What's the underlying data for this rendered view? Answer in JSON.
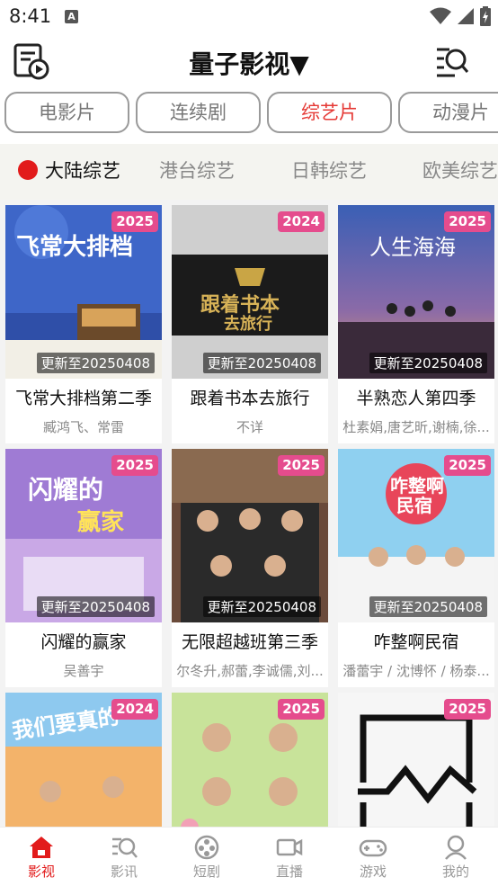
{
  "status": {
    "time": "8:41",
    "notif_letter": "A"
  },
  "header": {
    "title": "量子影视▼",
    "left_icon": "playlist-video-icon",
    "right_icon": "search-list-icon"
  },
  "categories": [
    {
      "label": "电影片",
      "active": false
    },
    {
      "label": "连续剧",
      "active": false
    },
    {
      "label": "综艺片",
      "active": true
    },
    {
      "label": "动漫片",
      "active": false
    }
  ],
  "subtabs": [
    {
      "label": "大陆综艺",
      "active": true
    },
    {
      "label": "港台综艺",
      "active": false
    },
    {
      "label": "日韩综艺",
      "active": false
    },
    {
      "label": "欧美综艺",
      "active": false
    }
  ],
  "cards": [
    {
      "title": "飞常大排档第二季",
      "cast": "臧鸿飞、常雷",
      "year": "2025",
      "update": "更新至20250408"
    },
    {
      "title": "跟着书本去旅行",
      "cast": "不详",
      "year": "2024",
      "update": "更新至20250408"
    },
    {
      "title": "半熟恋人第四季",
      "cast": "杜素娟,唐艺昕,谢楠,徐...",
      "year": "2025",
      "update": "更新至20250408"
    },
    {
      "title": "闪耀的赢家",
      "cast": "吴善宇",
      "year": "2025",
      "update": "更新至20250408"
    },
    {
      "title": "无限超越班第三季",
      "cast": "尔冬升,郝蕾,李诚儒,刘...",
      "year": "2025",
      "update": "更新至20250408"
    },
    {
      "title": "咋整啊民宿",
      "cast": "潘蕾宇 / 沈博怀 / 杨泰...",
      "year": "2025",
      "update": "更新至20250408"
    },
    {
      "title": "",
      "cast": "",
      "year": "2024",
      "update": ""
    },
    {
      "title": "",
      "cast": "",
      "year": "2025",
      "update": ""
    },
    {
      "title": "",
      "cast": "",
      "year": "2025",
      "update": ""
    }
  ],
  "bottom_nav": [
    {
      "label": "影视",
      "icon": "home-icon",
      "active": true
    },
    {
      "label": "影讯",
      "icon": "news-search-icon",
      "active": false
    },
    {
      "label": "短剧",
      "icon": "film-reel-icon",
      "active": false
    },
    {
      "label": "直播",
      "icon": "live-camera-icon",
      "active": false
    },
    {
      "label": "游戏",
      "icon": "gamepad-icon",
      "active": false
    },
    {
      "label": "我的",
      "icon": "user-icon",
      "active": false
    }
  ],
  "colors": {
    "accent": "#e21b1b",
    "year_badge": "#e54c8d"
  }
}
